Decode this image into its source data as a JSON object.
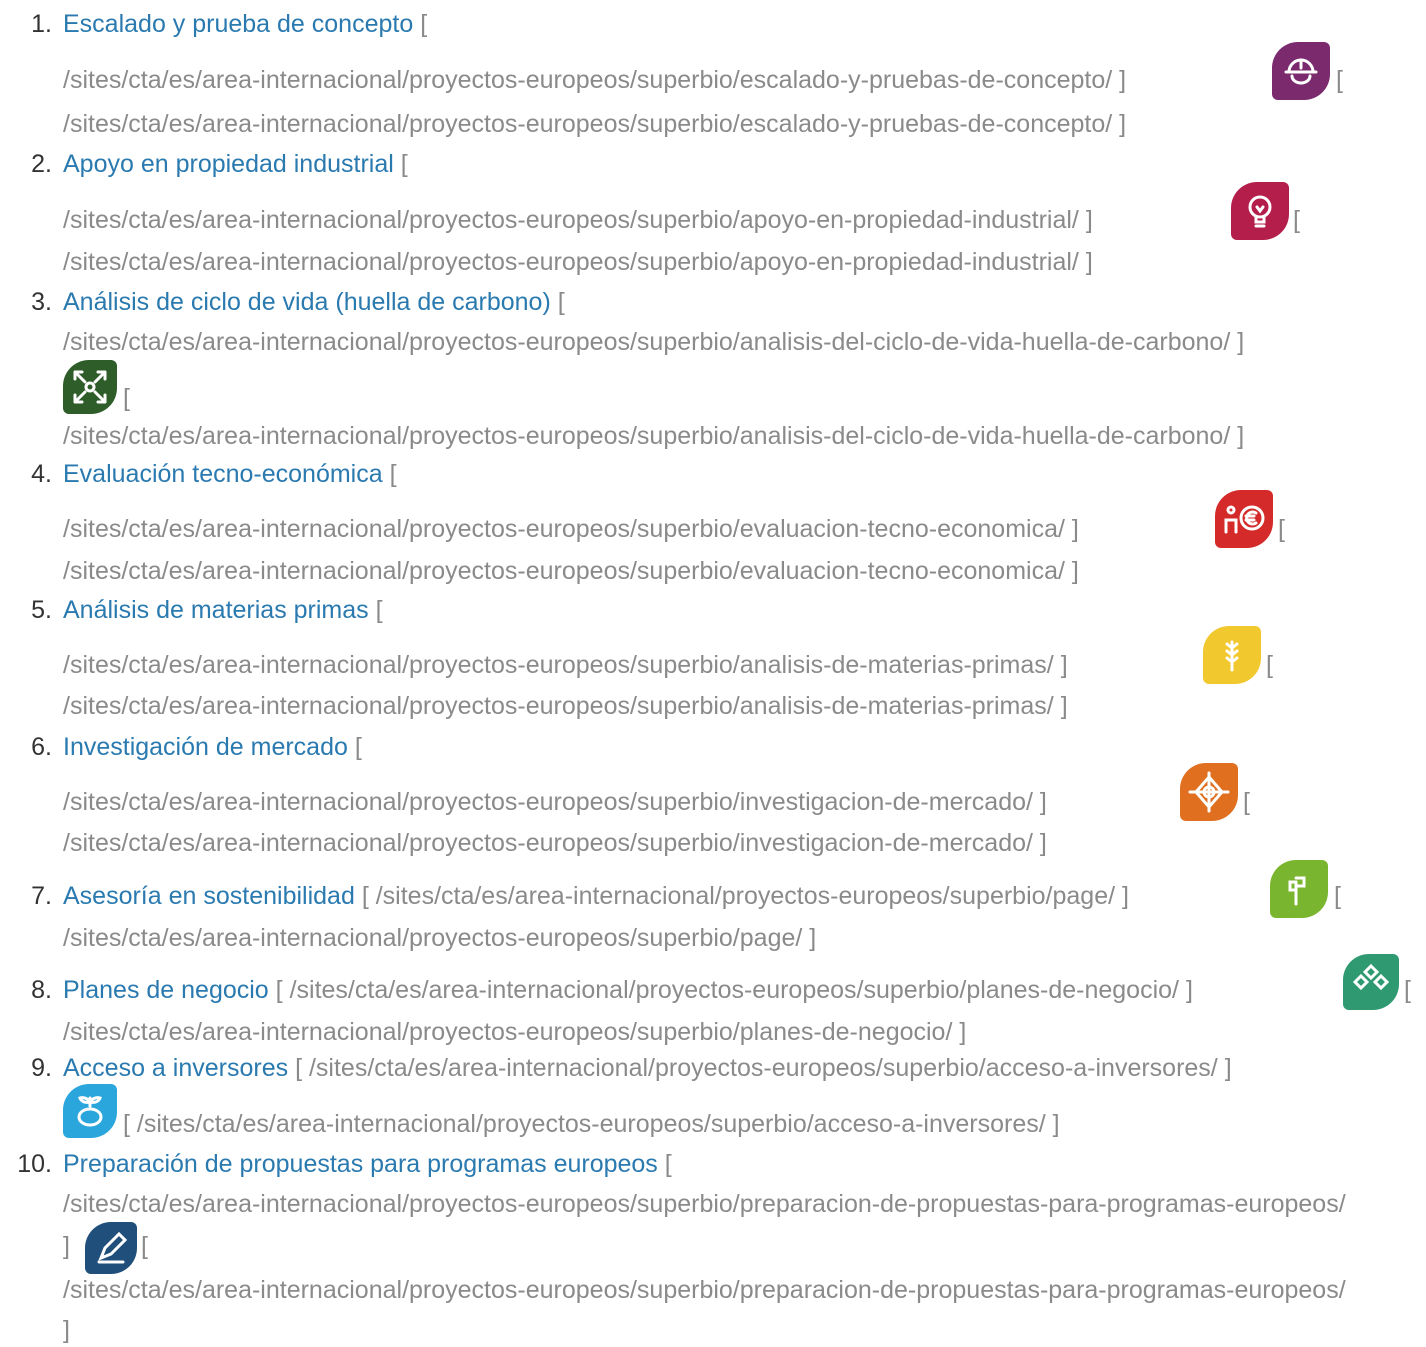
{
  "items": [
    {
      "num": "1.",
      "title": "Escalado y prueba de concepto",
      "url": "/sites/cta/es/area-internacional/proyectos-europeos/superbio/escalado-y-pruebas-de-concepto/",
      "icon": "helmet-icon",
      "color": "#7b2a6e"
    },
    {
      "num": "2.",
      "title": "Apoyo en propiedad industrial",
      "url": "/sites/cta/es/area-internacional/proyectos-europeos/superbio/apoyo-en-propiedad-industrial/",
      "icon": "lightbulb-icon",
      "color": "#b31e4a"
    },
    {
      "num": "3.",
      "title": "Análisis de ciclo de vida (huella de carbono)",
      "url": "/sites/cta/es/area-internacional/proyectos-europeos/superbio/analisis-del-ciclo-de-vida-huella-de-carbono/",
      "icon": "recycle-arrows-icon",
      "color": "#2f5d2a"
    },
    {
      "num": "4.",
      "title": "Evaluación tecno-económica",
      "url": "/sites/cta/es/area-internacional/proyectos-europeos/superbio/evaluacion-tecno-economica/",
      "icon": "euro-gear-icon",
      "color": "#d42a2a"
    },
    {
      "num": "5.",
      "title": "Análisis de materias primas",
      "url": "/sites/cta/es/area-internacional/proyectos-europeos/superbio/analisis-de-materias-primas/",
      "icon": "wheat-icon",
      "color": "#f2c82f"
    },
    {
      "num": "6.",
      "title": "Investigación de mercado",
      "url": "/sites/cta/es/area-internacional/proyectos-europeos/superbio/investigacion-de-mercado/",
      "icon": "target-icon",
      "color": "#e07020"
    },
    {
      "num": "7.",
      "title": "Asesoría en sostenibilidad",
      "url": "/sites/cta/es/area-internacional/proyectos-europeos/superbio/page/",
      "icon": "sprout-icon",
      "color": "#7ab52f"
    },
    {
      "num": "8.",
      "title": "Planes de negocio",
      "url": "/sites/cta/es/area-internacional/proyectos-europeos/superbio/planes-de-negocio/",
      "icon": "network-icon",
      "color": "#2f9a72"
    },
    {
      "num": "9.",
      "title": "Acceso a inversores",
      "url": "/sites/cta/es/area-internacional/proyectos-europeos/superbio/acceso-a-inversores/",
      "icon": "piggy-plant-icon",
      "color": "#2aa6dc"
    },
    {
      "num": "10.",
      "title": "Preparación de propuestas para programas europeos",
      "url": "/sites/cta/es/area-internacional/proyectos-europeos/superbio/preparacion-de-propuestas-para-programas-europeos/",
      "icon": "pencil-icon",
      "color": "#1f4f7a"
    }
  ],
  "bracket_open": "[",
  "bracket_close": "]"
}
